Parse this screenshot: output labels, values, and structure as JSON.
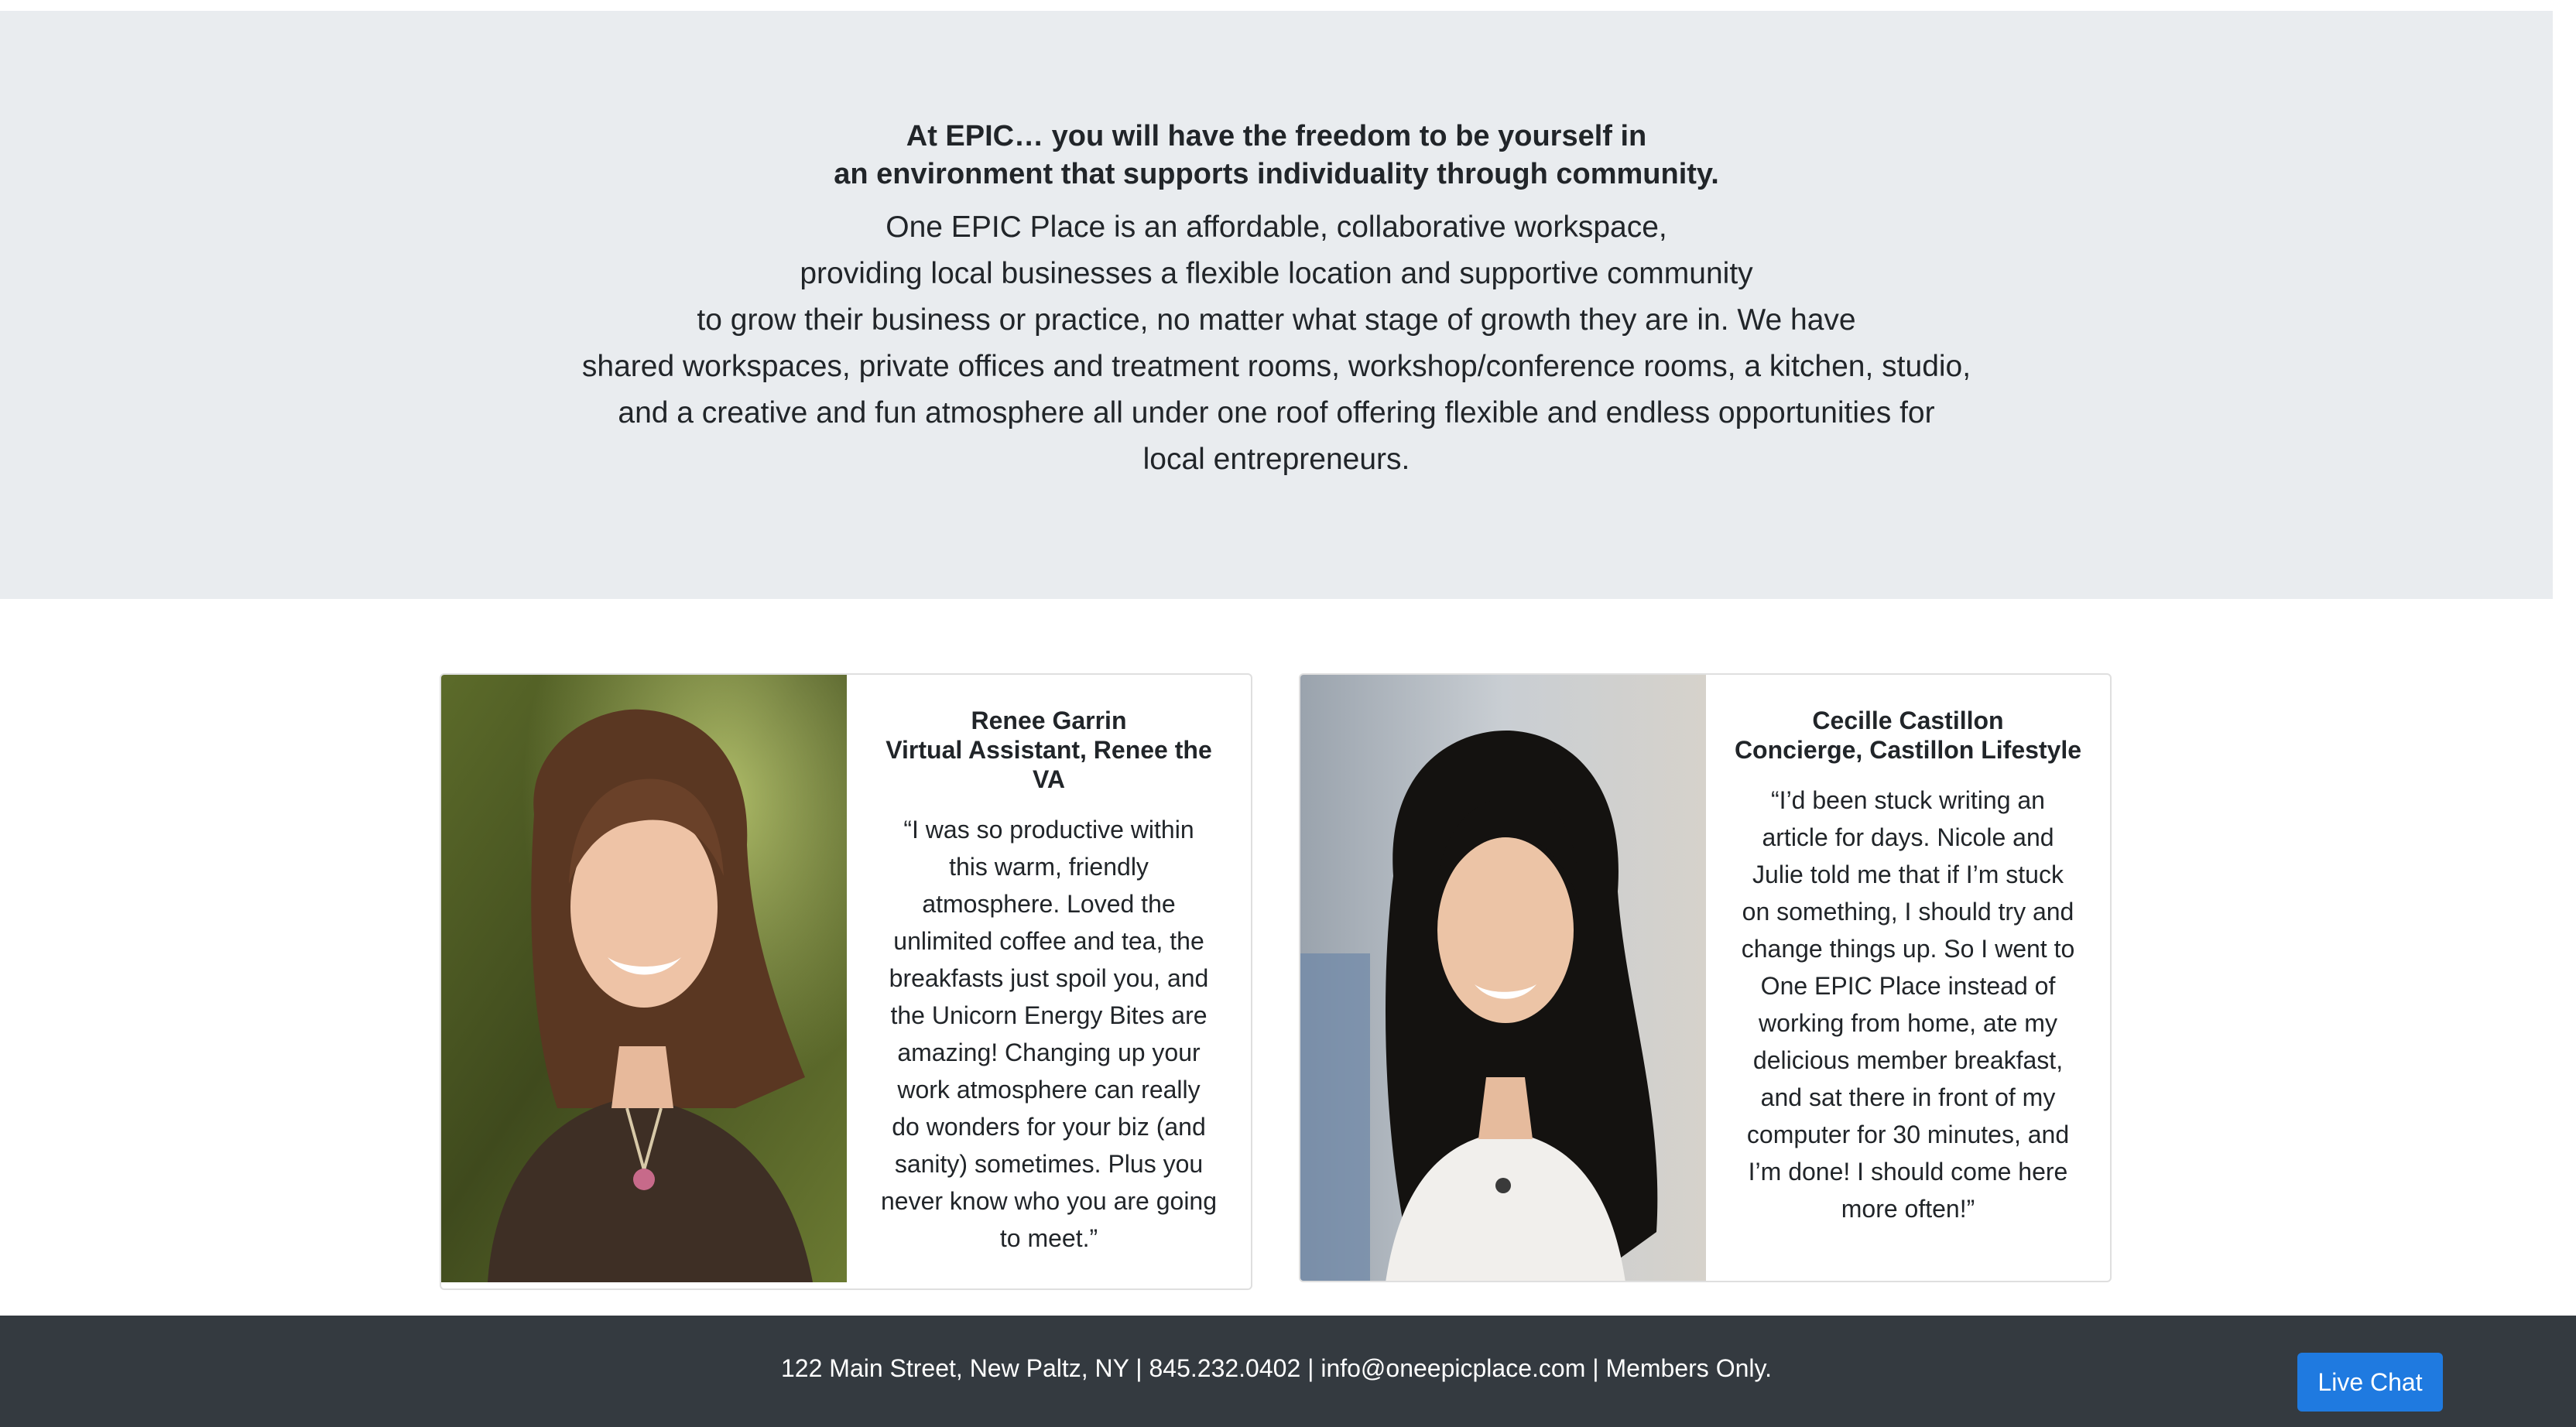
{
  "intro": {
    "heading_lines": [
      "At EPIC… you will have the freedom to be yourself in",
      "an environment that supports individuality through community."
    ],
    "body_lines": [
      "One EPIC Place is an affordable, collaborative workspace,",
      "providing local businesses a flexible location and supportive community",
      "to grow their business or practice, no matter what stage of growth they are in. We have",
      "shared workspaces, private offices and treatment rooms, workshop/conference rooms, a kitchen, studio,",
      "and a creative and fun atmosphere all under one roof offering flexible and endless opportunities for",
      "local entrepreneurs."
    ]
  },
  "testimonials": [
    {
      "name": "Renee Garrin",
      "title_lines": [
        "Virtual Assistant, Renee the",
        "VA"
      ],
      "quote_lines": [
        "“I was so productive within",
        "this warm, friendly",
        "atmosphere. Loved the",
        "unlimited coffee and tea, the",
        "breakfasts just spoil you, and",
        "the Unicorn Energy Bites are",
        "amazing! Changing up your",
        "work atmosphere can really",
        "do wonders for your biz (and",
        "sanity) sometimes. Plus you",
        "never know who you are going",
        "to meet.”"
      ]
    },
    {
      "name": "Cecille Castillon",
      "title_lines": [
        "Concierge, Castillon Lifestyle"
      ],
      "quote_lines": [
        "“I’d been stuck writing an",
        "article for days. Nicole and",
        "Julie told me that if I’m stuck",
        "on something, I should try and",
        "change things up. So I went to",
        "One EPIC Place instead of",
        "working from home, ate my",
        "delicious member breakfast,",
        "and sat there in front of my",
        "computer for 30 minutes, and",
        "I’m done! I should come here",
        "more often!”"
      ]
    }
  ],
  "footer": {
    "text": "122 Main Street, New Paltz, NY | 845.232.0402 | info@oneepicplace.com | Members Only."
  },
  "live_chat": {
    "label": "Live Chat"
  },
  "colors": {
    "intro_bg": "#e9ecef",
    "footer_bg": "#343a40",
    "chat_button": "#1f7ae0"
  }
}
